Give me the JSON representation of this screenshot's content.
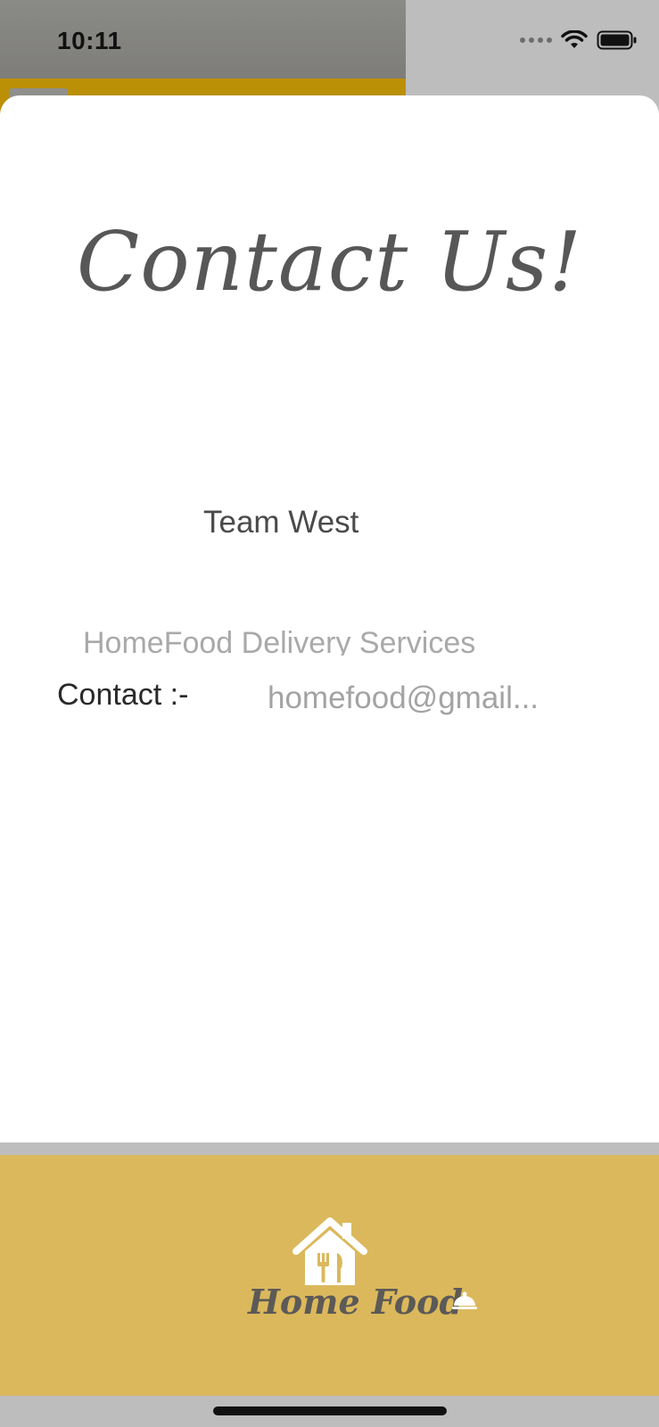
{
  "status_bar": {
    "time": "10:11"
  },
  "sheet": {
    "title": "Contact Us!",
    "team_name": "Team West",
    "company": "HomeFood Delivery Services",
    "contact_label": "Contact :-",
    "contact_email": "homefood@gmail..."
  },
  "tab_bar": {
    "logo_text": "Home Food",
    "icons": [
      "home-food-logo-icon",
      "cloche-icon"
    ]
  },
  "colors": {
    "tab_bar_background": "#dbb85c",
    "gold_strip": "#bb8f06",
    "sheet_background": "#ffffff",
    "title_color": "#575757"
  }
}
